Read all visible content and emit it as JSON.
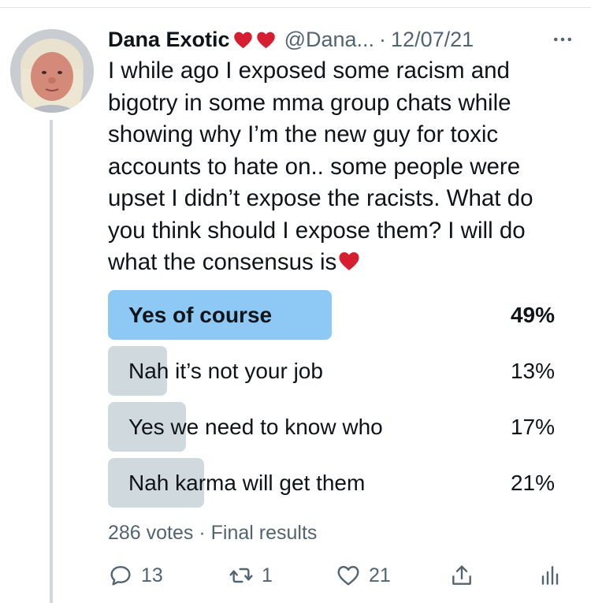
{
  "tweet": {
    "display_name": "Dana Exotic",
    "handle": "@Dana...",
    "separator": "·",
    "date": "12/07/21",
    "more_label": "more-options",
    "text": "I while ago I exposed some racism and bigotry in some mma group chats while showing why I’m the new guy for toxic accounts to hate on.. some people were upset I didn’t expose the racists. What do you think should I expose them? I will do what the consensus is",
    "heart_color": "#e0245e"
  },
  "poll": {
    "options": [
      {
        "label": "Yes of course",
        "percent": "49%",
        "fraction": 0.49,
        "winner": true
      },
      {
        "label": "Nah it’s not your job",
        "percent": "13%",
        "fraction": 0.13,
        "winner": false
      },
      {
        "label": "Yes we need to know who",
        "percent": "17%",
        "fraction": 0.17,
        "winner": false
      },
      {
        "label": "Nah karma will get them",
        "percent": "21%",
        "fraction": 0.21,
        "winner": false
      }
    ],
    "votes": "286 votes",
    "separator": "·",
    "status": "Final results",
    "winner_color": "#8ec8f5",
    "bar_color": "#cfd9de"
  },
  "actions": {
    "replies": "13",
    "retweets": "1",
    "likes": "21",
    "icons": [
      "reply-icon",
      "retweet-icon",
      "like-icon",
      "share-icon",
      "analytics-icon"
    ]
  }
}
